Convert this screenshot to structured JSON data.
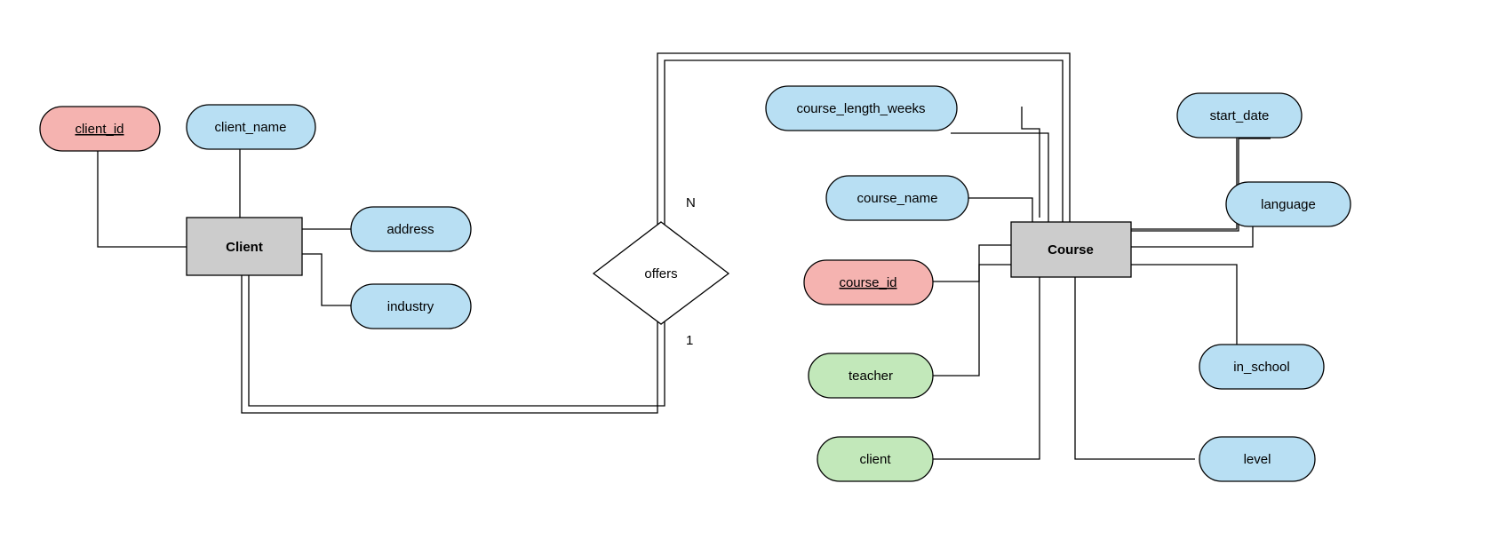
{
  "entities": {
    "client": {
      "label": "Client"
    },
    "course": {
      "label": "Course"
    }
  },
  "relationship": {
    "offers": {
      "label": "offers",
      "cardinality_top": "N",
      "cardinality_bottom": "1"
    }
  },
  "client_attrs": {
    "client_id": {
      "label": "client_id",
      "type": "key"
    },
    "client_name": {
      "label": "client_name",
      "type": "attr"
    },
    "address": {
      "label": "address",
      "type": "attr"
    },
    "industry": {
      "label": "industry",
      "type": "attr"
    }
  },
  "course_attrs": {
    "course_id": {
      "label": "course_id",
      "type": "key"
    },
    "course_name": {
      "label": "course_name",
      "type": "attr"
    },
    "course_length_weeks": {
      "label": "course_length_weeks",
      "type": "attr"
    },
    "start_date": {
      "label": "start_date",
      "type": "attr"
    },
    "language": {
      "label": "language",
      "type": "attr"
    },
    "in_school": {
      "label": "in_school",
      "type": "attr"
    },
    "level": {
      "label": "level",
      "type": "attr"
    },
    "teacher": {
      "label": "teacher",
      "type": "fk"
    },
    "client": {
      "label": "client",
      "type": "fk"
    }
  },
  "colors": {
    "entity": "#cccccc",
    "key": "#f5b3b0",
    "attr": "#b8dff3",
    "fk": "#c2e8ba",
    "diamond": "#ffffff"
  }
}
